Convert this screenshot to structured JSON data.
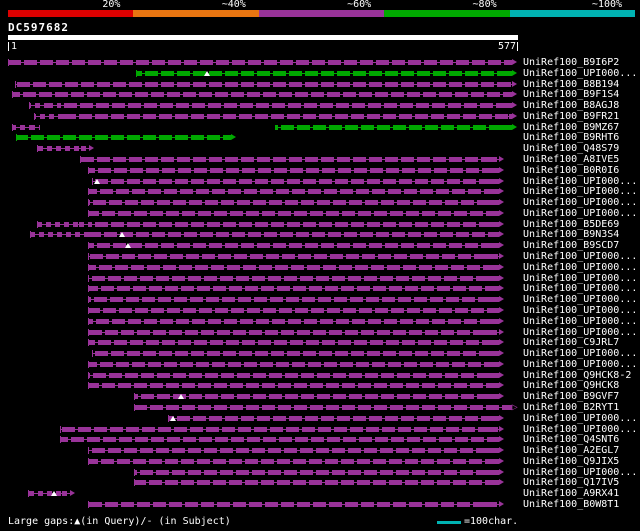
{
  "title": "DC597682",
  "colors": {
    "purple": "#993399",
    "green": "#00a800",
    "cyan": "#00b2b2",
    "red": "#dd0000",
    "orange": "#e87511",
    "white": "#ffffff",
    "background": "#000000"
  },
  "query": {
    "name": "DC597682",
    "start_label": "1",
    "end_label": "577"
  },
  "legend": {
    "gaps_text": "Large gaps:▲(in Query)/- (in Subject)",
    "scale_text": "=100char.",
    "scale_color": "#00b2b2"
  },
  "chart_data": {
    "type": "bar",
    "subtype": "sequence-similarity-alignment-overview",
    "title": "DC597682",
    "query_length": 577,
    "x_axis": {
      "start_label": "1",
      "end_label": "577"
    },
    "identity_scale": {
      "labels": [
        "20%",
        "~40%",
        "~60%",
        "~80%",
        "~100%"
      ],
      "colors": [
        "#dd0000",
        "#e87511",
        "#993399",
        "#00a800",
        "#00b2b2"
      ]
    },
    "rows": [
      {
        "label": "UniRef100_B9I6P2",
        "segments": [
          {
            "from": 1,
            "to": 570,
            "color": "purple"
          }
        ]
      },
      {
        "label": "UniRef100_UPI000...",
        "segments": [
          {
            "from": 146,
            "to": 570,
            "color": "green"
          }
        ],
        "gaps_in_query": [
          226
        ]
      },
      {
        "label": "UniRef100_B8B194",
        "segments": [
          {
            "from": 9,
            "to": 570,
            "color": "purple"
          }
        ]
      },
      {
        "label": "UniRef100_B9F1S4",
        "segments": [
          {
            "from": 5,
            "to": 570,
            "color": "purple"
          }
        ]
      },
      {
        "label": "UniRef100_B8AGJ8",
        "segments": [
          {
            "from": 25,
            "to": 60,
            "color": "purple",
            "style": "dotted"
          },
          {
            "from": 60,
            "to": 570,
            "color": "purple"
          }
        ]
      },
      {
        "label": "UniRef100_B9FR21",
        "segments": [
          {
            "from": 30,
            "to": 66,
            "color": "purple",
            "style": "dotted"
          },
          {
            "from": 66,
            "to": 570,
            "color": "purple"
          }
        ]
      },
      {
        "label": "UniRef100_B9MZ67",
        "segments": [
          {
            "from": 5,
            "to": 37,
            "color": "purple",
            "style": "dotted"
          },
          {
            "from": 303,
            "to": 570,
            "color": "green"
          }
        ]
      },
      {
        "label": "UniRef100_B9RHT6",
        "segments": [
          {
            "from": 10,
            "to": 253,
            "color": "green"
          }
        ]
      },
      {
        "label": "UniRef100_Q48S79",
        "segments": [
          {
            "from": 34,
            "to": 92,
            "color": "purple",
            "style": "dotted"
          }
        ]
      },
      {
        "label": "UniRef100_A8IVE5",
        "segments": [
          {
            "from": 82,
            "to": 555,
            "color": "purple"
          }
        ]
      },
      {
        "label": "UniRef100_B0R0I6",
        "segments": [
          {
            "from": 91,
            "to": 555,
            "color": "purple"
          }
        ]
      },
      {
        "label": "UniRef100_UPI000...",
        "segments": [
          {
            "from": 96,
            "to": 555,
            "color": "purple"
          }
        ],
        "gaps_in_query": [
          102
        ]
      },
      {
        "label": "UniRef100_UPI000...",
        "segments": [
          {
            "from": 91,
            "to": 555,
            "color": "purple"
          }
        ]
      },
      {
        "label": "UniRef100_UPI000...",
        "segments": [
          {
            "from": 91,
            "to": 555,
            "color": "purple"
          }
        ]
      },
      {
        "label": "UniRef100_UPI000...",
        "segments": [
          {
            "from": 91,
            "to": 555,
            "color": "purple"
          }
        ]
      },
      {
        "label": "UniRef100_B5DE69",
        "segments": [
          {
            "from": 34,
            "to": 91,
            "color": "purple",
            "style": "dotted"
          },
          {
            "from": 91,
            "to": 555,
            "color": "purple"
          }
        ]
      },
      {
        "label": "UniRef100_B9N3S4",
        "segments": [
          {
            "from": 26,
            "to": 91,
            "color": "purple",
            "style": "dotted"
          },
          {
            "from": 91,
            "to": 555,
            "color": "purple"
          }
        ],
        "gaps_in_query": [
          130
        ]
      },
      {
        "label": "UniRef100_B9SCD7",
        "segments": [
          {
            "from": 91,
            "to": 555,
            "color": "purple"
          }
        ],
        "gaps_in_query": [
          137
        ]
      },
      {
        "label": "UniRef100_UPI000...",
        "segments": [
          {
            "from": 91,
            "to": 555,
            "color": "purple"
          }
        ]
      },
      {
        "label": "UniRef100_UPI000...",
        "segments": [
          {
            "from": 91,
            "to": 555,
            "color": "purple"
          }
        ]
      },
      {
        "label": "UniRef100_UPI000...",
        "segments": [
          {
            "from": 91,
            "to": 555,
            "color": "purple"
          }
        ]
      },
      {
        "label": "UniRef100_UPI000...",
        "segments": [
          {
            "from": 91,
            "to": 555,
            "color": "purple"
          }
        ]
      },
      {
        "label": "UniRef100_UPI000...",
        "segments": [
          {
            "from": 91,
            "to": 555,
            "color": "purple"
          }
        ]
      },
      {
        "label": "UniRef100_UPI000...",
        "segments": [
          {
            "from": 91,
            "to": 555,
            "color": "purple"
          }
        ]
      },
      {
        "label": "UniRef100_UPI000...",
        "segments": [
          {
            "from": 91,
            "to": 555,
            "color": "purple"
          }
        ]
      },
      {
        "label": "UniRef100_UPI000...",
        "segments": [
          {
            "from": 91,
            "to": 555,
            "color": "purple"
          }
        ]
      },
      {
        "label": "UniRef100_C9JRL7",
        "segments": [
          {
            "from": 91,
            "to": 555,
            "color": "purple"
          }
        ]
      },
      {
        "label": "UniRef100_UPI000...",
        "segments": [
          {
            "from": 96,
            "to": 555,
            "color": "purple"
          }
        ]
      },
      {
        "label": "UniRef100_UPI000...",
        "segments": [
          {
            "from": 91,
            "to": 555,
            "color": "purple"
          }
        ]
      },
      {
        "label": "UniRef100_Q9HCK8-2",
        "segments": [
          {
            "from": 91,
            "to": 555,
            "color": "purple"
          }
        ]
      },
      {
        "label": "UniRef100_Q9HCK8",
        "segments": [
          {
            "from": 91,
            "to": 555,
            "color": "purple"
          }
        ]
      },
      {
        "label": "UniRef100_B9GVF7",
        "segments": [
          {
            "from": 143,
            "to": 555,
            "color": "purple"
          }
        ],
        "gaps_in_query": [
          196
        ]
      },
      {
        "label": "UniRef100_B2RYT1",
        "segments": [
          {
            "from": 143,
            "to": 570,
            "color": "purple"
          }
        ],
        "arrow": "open"
      },
      {
        "label": "UniRef100_UPI000...",
        "segments": [
          {
            "from": 182,
            "to": 555,
            "color": "purple"
          }
        ],
        "gaps_in_query": [
          187
        ]
      },
      {
        "label": "UniRef100_UPI000...",
        "segments": [
          {
            "from": 60,
            "to": 555,
            "color": "purple"
          }
        ]
      },
      {
        "label": "UniRef100_Q4SNT6",
        "segments": [
          {
            "from": 60,
            "to": 555,
            "color": "purple"
          }
        ]
      },
      {
        "label": "UniRef100_A2EGL7",
        "segments": [
          {
            "from": 91,
            "to": 555,
            "color": "purple"
          }
        ]
      },
      {
        "label": "UniRef100_Q9JIX5",
        "segments": [
          {
            "from": 91,
            "to": 555,
            "color": "purple"
          }
        ]
      },
      {
        "label": "UniRef100_UPI000...",
        "segments": [
          {
            "from": 143,
            "to": 555,
            "color": "purple"
          }
        ]
      },
      {
        "label": "UniRef100_Q17IV5",
        "segments": [
          {
            "from": 143,
            "to": 555,
            "color": "purple"
          }
        ]
      },
      {
        "label": "UniRef100_A9RX41",
        "segments": [
          {
            "from": 24,
            "to": 71,
            "color": "purple",
            "style": "dotted"
          }
        ],
        "gaps_in_query": [
          53
        ]
      },
      {
        "label": "UniRef100_B0W8T1",
        "segments": [
          {
            "from": 91,
            "to": 555,
            "color": "purple"
          }
        ]
      }
    ]
  }
}
